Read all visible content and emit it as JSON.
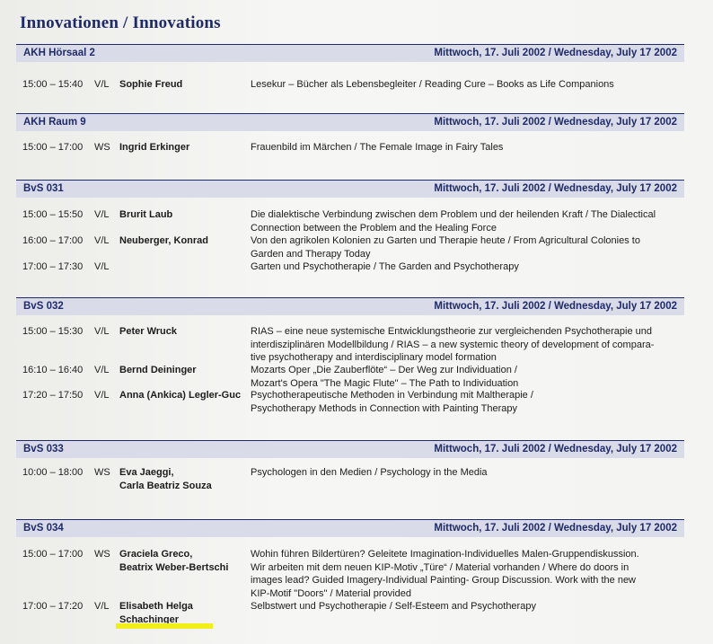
{
  "page_title": "Innovationen / Innovations",
  "sections": [
    {
      "room": "AKH Hörsaal 2",
      "date": "Mittwoch, 17. Juli 2002 / Wednesday, July 17 2002",
      "rows": [
        {
          "time": "15:00 – 15:40",
          "type": "V/L",
          "who": [
            "Sophie Freud"
          ],
          "desc": [
            "Lesekur – Bücher als Lebensbegleiter / Reading Cure – Books as Life Companions"
          ]
        }
      ]
    },
    {
      "room": "AKH Raum 9",
      "date": "Mittwoch, 17. Juli 2002 / Wednesday, July 17 2002",
      "rows": [
        {
          "time": "15:00 – 17:00",
          "type": "WS",
          "who": [
            "Ingrid Erkinger"
          ],
          "desc": [
            "Frauenbild im Märchen / The Female Image in Fairy Tales"
          ]
        }
      ]
    },
    {
      "room": "BvS 031",
      "date": "Mittwoch, 17. Juli 2002 / Wednesday, July 17 2002",
      "rows": [
        {
          "time": "15:00 – 15:50",
          "type": "V/L",
          "who": [
            "Brurit Laub"
          ],
          "desc": [
            "Die dialektische Verbindung zwischen dem Problem und der heilenden Kraft / The Dialectical",
            "Connection between the Problem and the Healing Force"
          ]
        },
        {
          "time": "16:00 – 17:00",
          "type": "V/L",
          "who": [
            "Neuberger, Konrad"
          ],
          "desc": [
            "Von den agrikolen Kolonien zu Garten und Therapie heute / From Agricultural Colonies to",
            "Garden and Therapy Today"
          ]
        },
        {
          "time": "17:00 – 17:30",
          "type": "V/L",
          "who": [
            ""
          ],
          "desc": [
            "Garten und Psychotherapie / The Garden and Psychotherapy"
          ]
        }
      ]
    },
    {
      "room": "BvS 032",
      "date": "Mittwoch, 17. Juli 2002 / Wednesday, July 17 2002",
      "rows": [
        {
          "time": "15:00 – 15:30",
          "type": "V/L",
          "who": [
            "Peter Wruck"
          ],
          "desc": [
            "RIAS – eine neue systemische Entwicklungstheorie zur vergleichenden Psychotherapie und",
            "interdisziplinären Modellbildung / RIAS – a new systemic theory of development of compara-",
            "tive psychotherapy and interdisciplinary model formation"
          ]
        },
        {
          "time": "16:10 – 16:40",
          "type": "V/L",
          "who": [
            "Bernd Deininger"
          ],
          "desc": [
            "Mozarts Oper „Die Zauberflöte“ – Der Weg zur Individuation /",
            "Mozart's Opera \"The Magic Flute\" – The Path to Individuation"
          ]
        },
        {
          "time": "17:20 – 17:50",
          "type": "V/L",
          "who": [
            "Anna (Ankica) Legler-Guc"
          ],
          "desc": [
            "Psychotherapeutische Methoden in Verbindung mit Maltherapie /",
            "Psychotherapy Methods in Connection with Painting Therapy"
          ]
        }
      ]
    },
    {
      "room": "BvS 033",
      "date": "Mittwoch, 17. Juli 2002 / Wednesday, July 17 2002",
      "rows": [
        {
          "time": "10:00 – 18:00",
          "type": "WS",
          "who": [
            "Eva Jaeggi,",
            "Carla Beatriz Souza"
          ],
          "desc": [
            "Psychologen in den Medien / Psychology in the Media"
          ]
        }
      ]
    },
    {
      "room": "BvS 034",
      "date": "Mittwoch, 17. Juli 2002 / Wednesday, July 17 2002",
      "rows": [
        {
          "time": "15:00 – 17:00",
          "type": "WS",
          "who": [
            "Graciela Greco,",
            "Beatrix Weber-Bertschi"
          ],
          "desc": [
            "Wohin führen Bildertüren? Geleitete Imagination-Individuelles Malen-Gruppendiskussion.",
            "Wir arbeiten mit dem neuen KIP-Motiv „Türe“ / Material vorhanden / Where do doors in",
            "images lead? Guided Imagery-Individual Painting- Group Discussion. Work with the new",
            "KIP-Motif \"Doors\" / Material provided"
          ]
        },
        {
          "time": "17:00 – 17:20",
          "type": "V/L",
          "who": [
            "Elisabeth Helga",
            "Schachinger"
          ],
          "desc": [
            "Selbstwert und Psychotherapie / Self-Esteem and Psychotherapy"
          ]
        }
      ]
    }
  ]
}
